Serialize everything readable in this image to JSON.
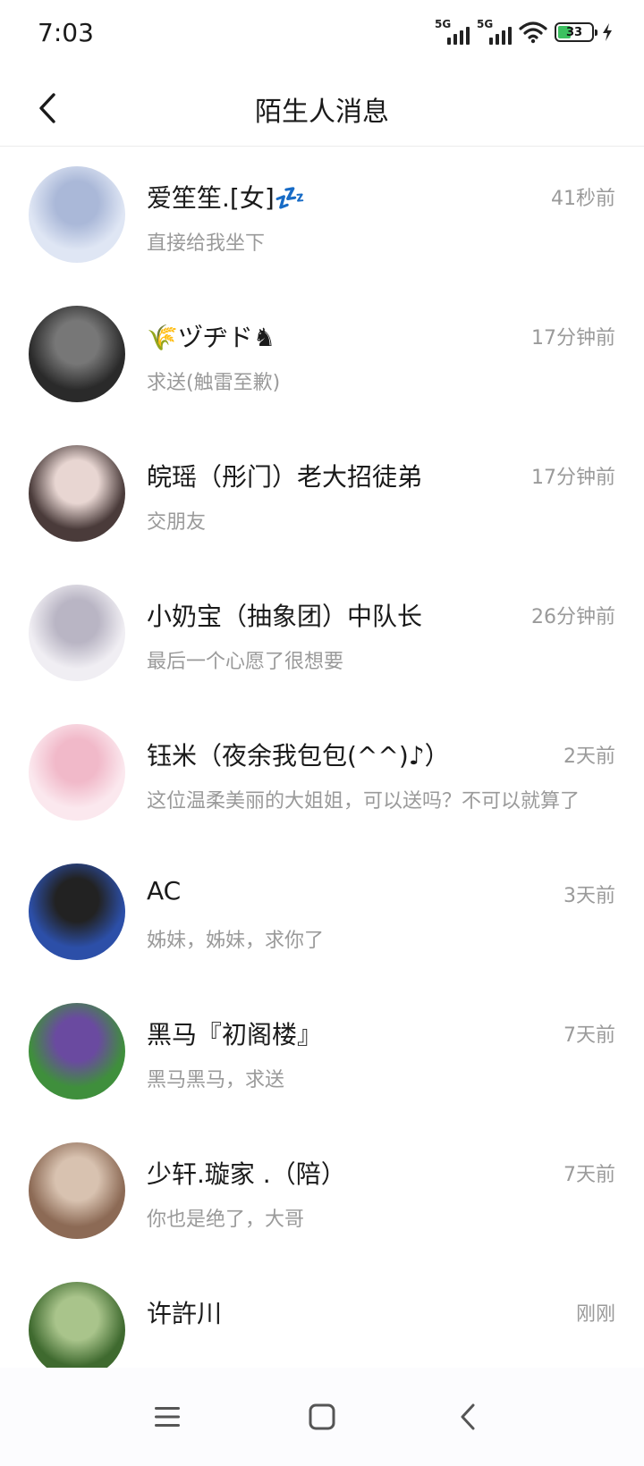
{
  "status_bar": {
    "time": "7:03",
    "network_1": "5G",
    "network_2": "5G",
    "battery_level": "33",
    "icons": [
      "signal-icon",
      "signal-icon",
      "wifi-icon",
      "battery-icon",
      "charging-icon"
    ]
  },
  "header": {
    "title": "陌生人消息",
    "back_icon": "back-arrow-icon"
  },
  "conversations": [
    {
      "name": "爱笙笙.[女]💤",
      "time": "41秒前",
      "preview": "直接给我坐下",
      "avatar_colors": [
        "#dfe6f4",
        "#aab8d8"
      ]
    },
    {
      "name": "🌾ヅヂド♞",
      "time": "17分钟前",
      "preview": "求送(触雷至歉)",
      "avatar_colors": [
        "#2a2a2a",
        "#777777"
      ]
    },
    {
      "name": "皖瑶（彤门）老大招徒弟",
      "time": "17分钟前",
      "preview": "交朋友",
      "avatar_colors": [
        "#4a3b3a",
        "#e8d6d2"
      ]
    },
    {
      "name": "小奶宝（抽象团）中队长",
      "time": "26分钟前",
      "preview": "最后一个心愿了很想要",
      "avatar_colors": [
        "#f0eef3",
        "#b9b5c4"
      ]
    },
    {
      "name": "钰米（夜余我包包(^^)♪）",
      "time": "2天前",
      "preview": "这位温柔美丽的大姐姐，可以送吗？不可以就算了",
      "avatar_colors": [
        "#fbe8ee",
        "#f1b9c9"
      ]
    },
    {
      "name": "AC",
      "time": "3天前",
      "preview": "姊妹，姊妹，求你了",
      "avatar_colors": [
        "#2c4fa8",
        "#222222"
      ]
    },
    {
      "name": "黑马『初阁楼』",
      "time": "7天前",
      "preview": "黑马黑马，求送",
      "avatar_colors": [
        "#3f8f3c",
        "#6a4aa0"
      ]
    },
    {
      "name": "少轩.璇家 .（陪）",
      "time": "7天前",
      "preview": "你也是绝了，大哥",
      "avatar_colors": [
        "#8c6a55",
        "#d8c2b0"
      ]
    },
    {
      "name": "许許川",
      "time": "刚刚",
      "preview": "",
      "avatar_colors": [
        "#3f6a2f",
        "#a9c48b"
      ]
    }
  ],
  "bottom_nav": {
    "icons": [
      "menu-icon",
      "home-icon",
      "back-icon"
    ]
  }
}
